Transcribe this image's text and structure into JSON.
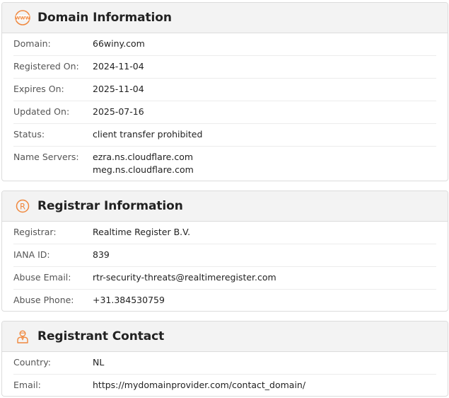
{
  "domain_info": {
    "title": "Domain Information",
    "icon": "www-globe-icon",
    "rows": [
      {
        "label": "Domain:",
        "value": "66winy.com"
      },
      {
        "label": "Registered On:",
        "value": "2024-11-04"
      },
      {
        "label": "Expires On:",
        "value": "2025-11-04"
      },
      {
        "label": "Updated On:",
        "value": "2025-07-16"
      },
      {
        "label": "Status:",
        "value": "client transfer prohibited"
      }
    ],
    "name_servers": {
      "label": "Name Servers:",
      "values": [
        "ezra.ns.cloudflare.com",
        "meg.ns.cloudflare.com"
      ]
    }
  },
  "registrar_info": {
    "title": "Registrar Information",
    "icon": "registered-icon",
    "rows": [
      {
        "label": "Registrar:",
        "value": "Realtime Register B.V."
      },
      {
        "label": "IANA ID:",
        "value": "839"
      },
      {
        "label": "Abuse Email:",
        "value": "rtr-security-threats@realtimeregister.com"
      },
      {
        "label": "Abuse Phone:",
        "value": "+31.384530759"
      }
    ]
  },
  "registrant_contact": {
    "title": "Registrant Contact",
    "icon": "user-icon",
    "rows": [
      {
        "label": "Country:",
        "value": "NL"
      },
      {
        "label": "Email:",
        "value": "https://mydomainprovider.com/contact_domain/"
      }
    ]
  },
  "colors": {
    "accent": "#f0883e",
    "header_bg": "#f3f3f3",
    "border": "#dcdcdc"
  }
}
